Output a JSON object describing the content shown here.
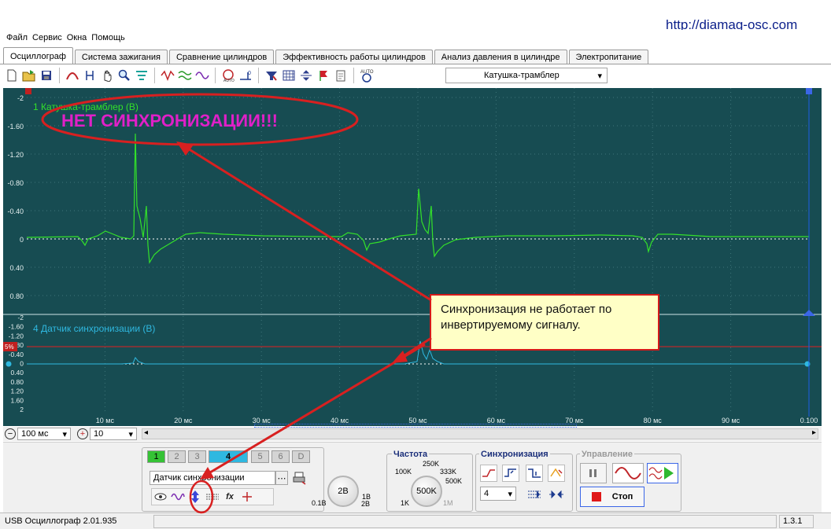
{
  "url": "http://diamag-osc.com",
  "menu": [
    "Файл",
    "Сервис",
    "Окна",
    "Помощь"
  ],
  "tabs": [
    "Осциллограф",
    "Система зажигания",
    "Сравнение цилиндров",
    "Эффективность работы цилиндров",
    "Анализ давления в цилиндре",
    "Электропитание"
  ],
  "active_tab": 0,
  "toolbar": {
    "combo_value": "Катушка-трамблер",
    "icons": [
      "new-icon",
      "open-icon",
      "save-icon",
      "measure-icon",
      "cursor-icon",
      "hand-icon",
      "zoom-icon",
      "filter-icon",
      "wave-icon",
      "multiwave-icon",
      "overlay-icon",
      "auto-icon",
      "zero-icon",
      "trigger-icon",
      "grid-icon",
      "split-icon",
      "marker-icon",
      "notes-icon",
      "auto-setup-icon"
    ]
  },
  "scope": {
    "channel1_label": "1 Катушка-трамблер (В)",
    "channel4_label": "4 Датчик синхронизации (В)",
    "ch1_ticks": [
      "-2",
      "-1.60",
      "-1.20",
      "-0.80",
      "-0.40",
      "0",
      "0.40",
      "0.80"
    ],
    "ch4_ticks": [
      "-2",
      "-1.60",
      "-1.20",
      "-0.80",
      "-0.40",
      "0",
      "0.40",
      "0.80",
      "1.20",
      "1.60",
      "2"
    ],
    "time_ticks": [
      "10 мс",
      "20 мс",
      "30 мс",
      "40 мс",
      "50 мс",
      "60 мс",
      "70 мс",
      "80 мс",
      "90 мс",
      "0.100"
    ],
    "trigger_marker": "5%",
    "colors": {
      "bg": "#174c52",
      "ch1": "#33e02a",
      "ch4": "#2fb8e0",
      "trigger": "#e02020"
    }
  },
  "annotation": {
    "no_sync": "НЕТ СИНХРОНИЗАЦИИ!!!",
    "callout": "Синхронизация не работает по инвертируемому сигналу."
  },
  "scale_bar": {
    "time_value": "100 мс",
    "zoom_value": "10"
  },
  "panel": {
    "channels": [
      "1",
      "2",
      "3",
      "4",
      "5",
      "6",
      "D"
    ],
    "sensor": "Датчик синхронизации",
    "voltage_value": "2В",
    "voltage_min": "0.1В",
    "voltage_max": "2В",
    "voltage_mid": "1В",
    "freq_title": "Частота",
    "freq_value": "500K",
    "freq_labels": [
      "250K",
      "100K",
      "333K",
      "500K",
      "1K",
      "1M"
    ],
    "sync_title": "Синхронизация",
    "sync_channel": "4",
    "control_title": "Управление",
    "stop_label": "Стоп"
  },
  "status": {
    "app": "USB Осциллограф  2.01.935",
    "version": "1.3.1"
  }
}
